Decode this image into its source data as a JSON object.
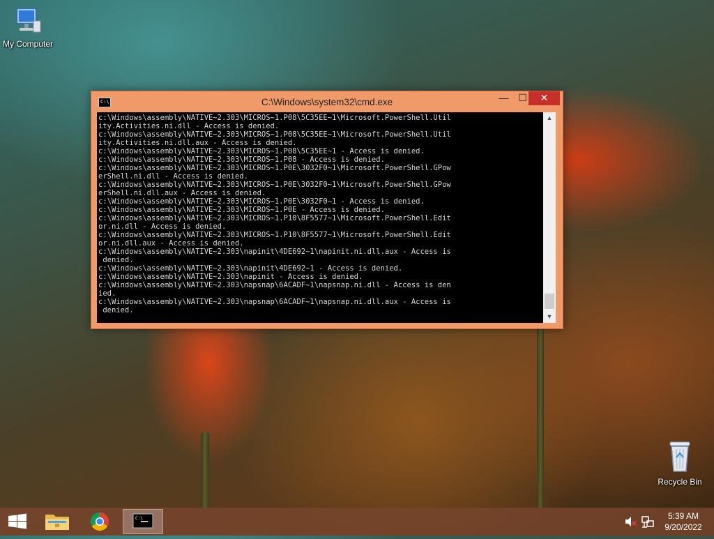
{
  "desktop": {
    "icons": [
      {
        "label": "My Computer",
        "icon": "computer-icon"
      },
      {
        "label": "Recycle Bin",
        "icon": "recycle-bin-icon"
      }
    ]
  },
  "cmd_window": {
    "title": "C:\\Windows\\system32\\cmd.exe",
    "minimize": "—",
    "maximize": "☐",
    "close": "✕",
    "lines": [
      "c:\\Windows\\assembly\\NATIVE~2.303\\MICROS~1.P08\\5C35EE~1\\Microsoft.PowerShell.Util",
      "ity.Activities.ni.dll - Access is denied.",
      "c:\\Windows\\assembly\\NATIVE~2.303\\MICROS~1.P08\\5C35EE~1\\Microsoft.PowerShell.Util",
      "ity.Activities.ni.dll.aux - Access is denied.",
      "c:\\Windows\\assembly\\NATIVE~2.303\\MICROS~1.P08\\5C35EE~1 - Access is denied.",
      "c:\\Windows\\assembly\\NATIVE~2.303\\MICROS~1.P08 - Access is denied.",
      "c:\\Windows\\assembly\\NATIVE~2.303\\MICROS~1.P0E\\3032F0~1\\Microsoft.PowerShell.GPow",
      "erShell.ni.dll - Access is denied.",
      "c:\\Windows\\assembly\\NATIVE~2.303\\MICROS~1.P0E\\3032F0~1\\Microsoft.PowerShell.GPow",
      "erShell.ni.dll.aux - Access is denied.",
      "c:\\Windows\\assembly\\NATIVE~2.303\\MICROS~1.P0E\\3032F0~1 - Access is denied.",
      "c:\\Windows\\assembly\\NATIVE~2.303\\MICROS~1.P0E - Access is denied.",
      "c:\\Windows\\assembly\\NATIVE~2.303\\MICROS~1.P10\\8F5577~1\\Microsoft.PowerShell.Edit",
      "or.ni.dll - Access is denied.",
      "c:\\Windows\\assembly\\NATIVE~2.303\\MICROS~1.P10\\8F5577~1\\Microsoft.PowerShell.Edit",
      "or.ni.dll.aux - Access is denied.",
      "c:\\Windows\\assembly\\NATIVE~2.303\\napinit\\4DE692~1\\napinit.ni.dll.aux - Access is",
      " denied.",
      "c:\\Windows\\assembly\\NATIVE~2.303\\napinit\\4DE692~1 - Access is denied.",
      "c:\\Windows\\assembly\\NATIVE~2.303\\napinit - Access is denied.",
      "c:\\Windows\\assembly\\NATIVE~2.303\\napsnap\\6ACADF~1\\napsnap.ni.dll - Access is den",
      "ied.",
      "c:\\Windows\\assembly\\NATIVE~2.303\\napsnap\\6ACADF~1\\napsnap.ni.dll.aux - Access is",
      " denied."
    ]
  },
  "taskbar": {
    "items": [
      {
        "name": "start",
        "icon": "windows-logo-icon"
      },
      {
        "name": "file-explorer",
        "icon": "folder-icon"
      },
      {
        "name": "chrome",
        "icon": "chrome-icon"
      },
      {
        "name": "cmd",
        "icon": "cmd-icon",
        "active": true
      }
    ],
    "tray": {
      "volume": "volume-muted-icon",
      "network": "network-icon"
    },
    "clock": {
      "time": "5:39 AM",
      "date": "9/20/2022"
    }
  }
}
